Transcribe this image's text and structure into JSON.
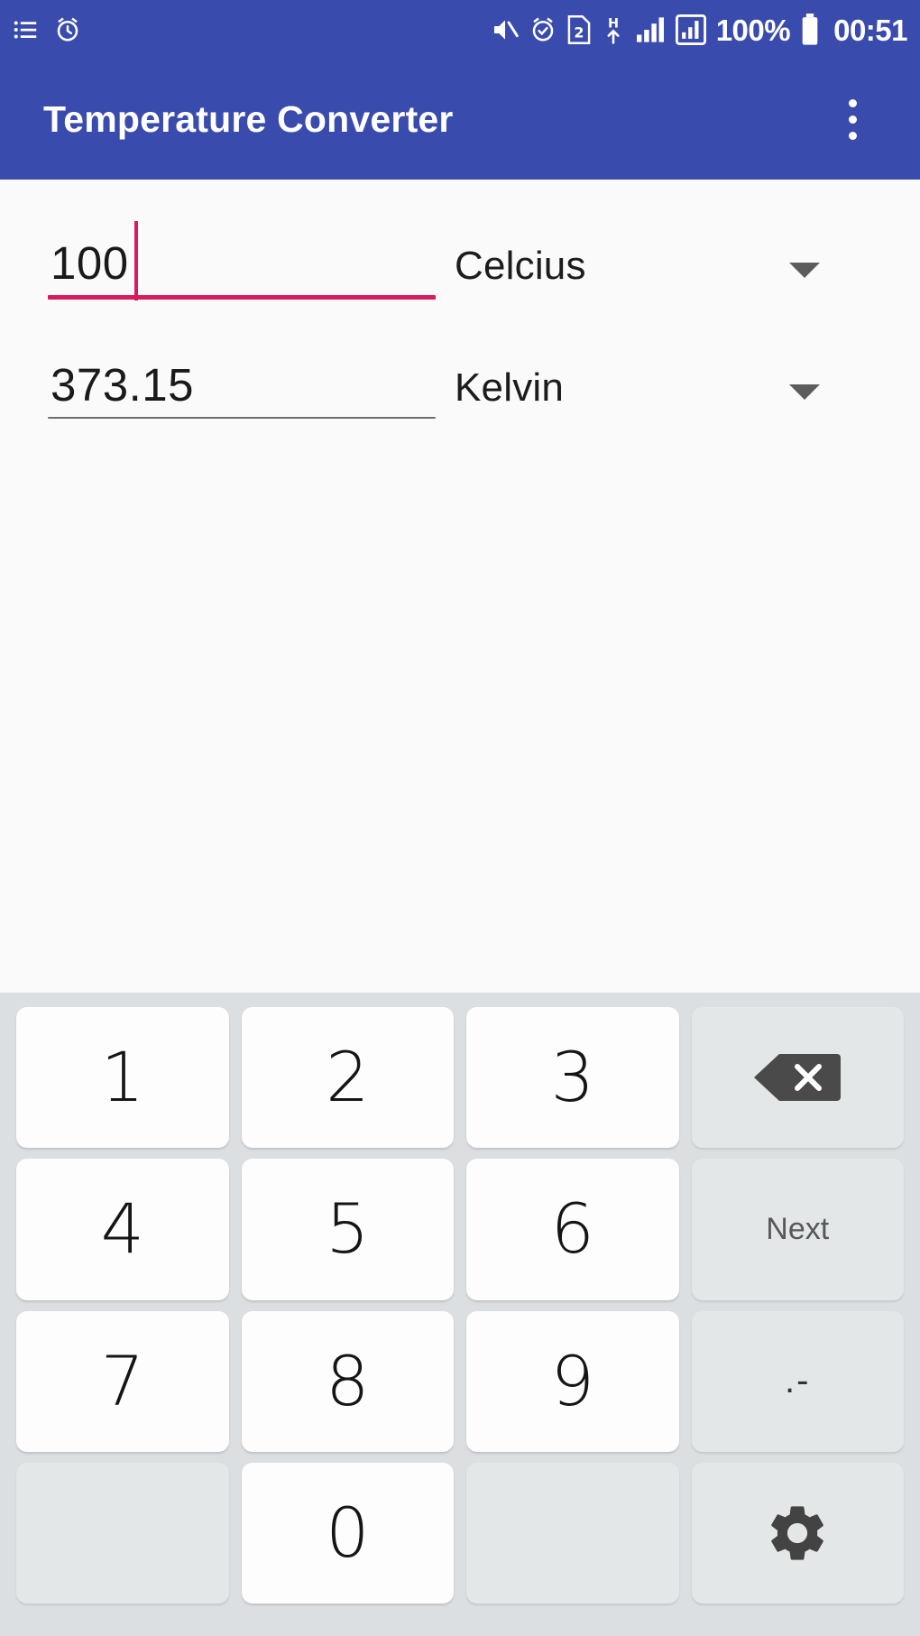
{
  "status_bar": {
    "left_icons": [
      "list-icon",
      "alarm-clock-icon"
    ],
    "right_icons": [
      "mute-icon",
      "alarm-active-icon",
      "sim-2-icon",
      "hsdpa-icon",
      "signal-bars-icon",
      "signal-chart-icon"
    ],
    "battery_percent": "100%",
    "battery_icon": "battery-full-icon",
    "clock": "00:51",
    "background_color": "#3A4BAE"
  },
  "app_bar": {
    "title": "Temperature Converter",
    "overflow_icon": "overflow-menu-icon",
    "background_color": "#3A4BAE",
    "text_color": "#FFFFFF"
  },
  "converter": {
    "rows": [
      {
        "value": "100",
        "unit": "Celcius",
        "focused": true,
        "caret_visible": true,
        "underline_color": "#D81B60",
        "dropdown_icon": "chevron-down-icon"
      },
      {
        "value": "373.15",
        "unit": "Kelvin",
        "focused": false,
        "caret_visible": false,
        "underline_color": "#6E6E6E",
        "dropdown_icon": "chevron-down-icon"
      }
    ]
  },
  "keyboard": {
    "background_color": "#DCDFE2",
    "rows": [
      [
        {
          "label": "1",
          "type": "digit",
          "style": "light"
        },
        {
          "label": "2",
          "type": "digit",
          "style": "light"
        },
        {
          "label": "3",
          "type": "digit",
          "style": "light"
        },
        {
          "label": "",
          "type": "backspace-icon",
          "style": "dim"
        }
      ],
      [
        {
          "label": "4",
          "type": "digit",
          "style": "light"
        },
        {
          "label": "5",
          "type": "digit",
          "style": "light"
        },
        {
          "label": "6",
          "type": "digit",
          "style": "light"
        },
        {
          "label": "Next",
          "type": "word",
          "style": "dim"
        }
      ],
      [
        {
          "label": "7",
          "type": "digit",
          "style": "light"
        },
        {
          "label": "8",
          "type": "digit",
          "style": "light"
        },
        {
          "label": "9",
          "type": "digit",
          "style": "light"
        },
        {
          "label": ".-",
          "type": "punct",
          "style": "dim"
        }
      ],
      [
        {
          "label": "",
          "type": "blank",
          "style": "blank"
        },
        {
          "label": "0",
          "type": "digit",
          "style": "light"
        },
        {
          "label": "",
          "type": "blank",
          "style": "blank"
        },
        {
          "label": "",
          "type": "gear-icon",
          "style": "dim"
        }
      ]
    ]
  }
}
